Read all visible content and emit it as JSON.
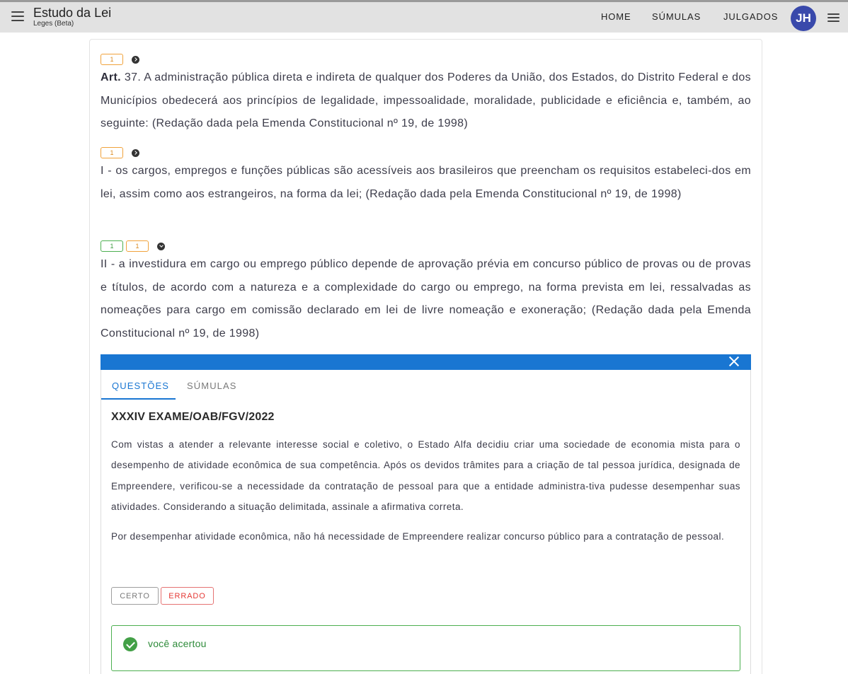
{
  "appbar": {
    "title": "Estudo da Lei",
    "subtitle": "Leges (Beta)",
    "nav": {
      "home": "HOME",
      "sumulas": "SÚMULAS",
      "julgados": "JULGADOS"
    },
    "avatar_initials": "JH"
  },
  "article": {
    "caput_label": "Art.",
    "caput_text": " 37. A administração pública direta e indireta de qualquer dos Poderes da União, dos Estados, do Distrito Federal e dos Municípios obedecerá aos princípios de legalidade, impessoalidade, moralidade, publicidade e eficiência e, também, ao seguinte: (Redação dada pela Emenda Constitucional nº 19, de 1998)",
    "caput_badges": [
      "1"
    ],
    "inciso_i": "I - os cargos, empregos e funções públicas são acessíveis aos brasileiros que preencham os requisitos estabeleci-dos em lei, assim como aos estrangeiros, na forma da lei; (Redação dada pela Emenda Constitucional nº 19, de 1998)",
    "inciso_i_badges": [
      "1"
    ],
    "inciso_ii": "II - a investidura em cargo ou emprego público depende de aprovação prévia em concurso público de provas ou de provas e títulos, de acordo com a natureza e a complexidade do cargo ou emprego, na forma prevista em lei, ressalvadas as nomeações para cargo em comissão declarado em lei de livre nomeação e exoneração; (Redação dada pela Emenda Constitucional nº 19, de 1998)",
    "inciso_ii_badges": [
      "1",
      "1"
    ]
  },
  "panel": {
    "tabs": {
      "questoes": "QUESTÕES",
      "sumulas": "SÚMULAS"
    },
    "question_title": "XXXIV EXAME/OAB/FGV/2022",
    "question_text": "Com vistas a atender a relevante interesse social e coletivo, o Estado Alfa decidiu criar uma sociedade de economia mista para o desempenho de atividade econômica de sua competência. Após os devidos trâmites para a criação de tal pessoa jurídica, designada de Empreendere, verificou-se a necessidade da contratação de pessoal para que a entidade administra-tiva pudesse desempenhar suas atividades. Considerando a situação delimitada, assinale a afirmativa correta.",
    "statement": "Por desempenhar atividade econômica, não há necessidade de Empreendere realizar concurso público para a contratação de pessoal.",
    "buttons": {
      "certo": "CERTO",
      "errado": "ERRADO"
    },
    "result": "você acertou"
  },
  "colors": {
    "appbar_bg": "#e2e2e2",
    "accent": "#1976d2",
    "avatar": "#3949ab",
    "badge_orange": "#f0a23b",
    "badge_green": "#4caf50",
    "error": "#e53935",
    "success": "#43a047"
  }
}
